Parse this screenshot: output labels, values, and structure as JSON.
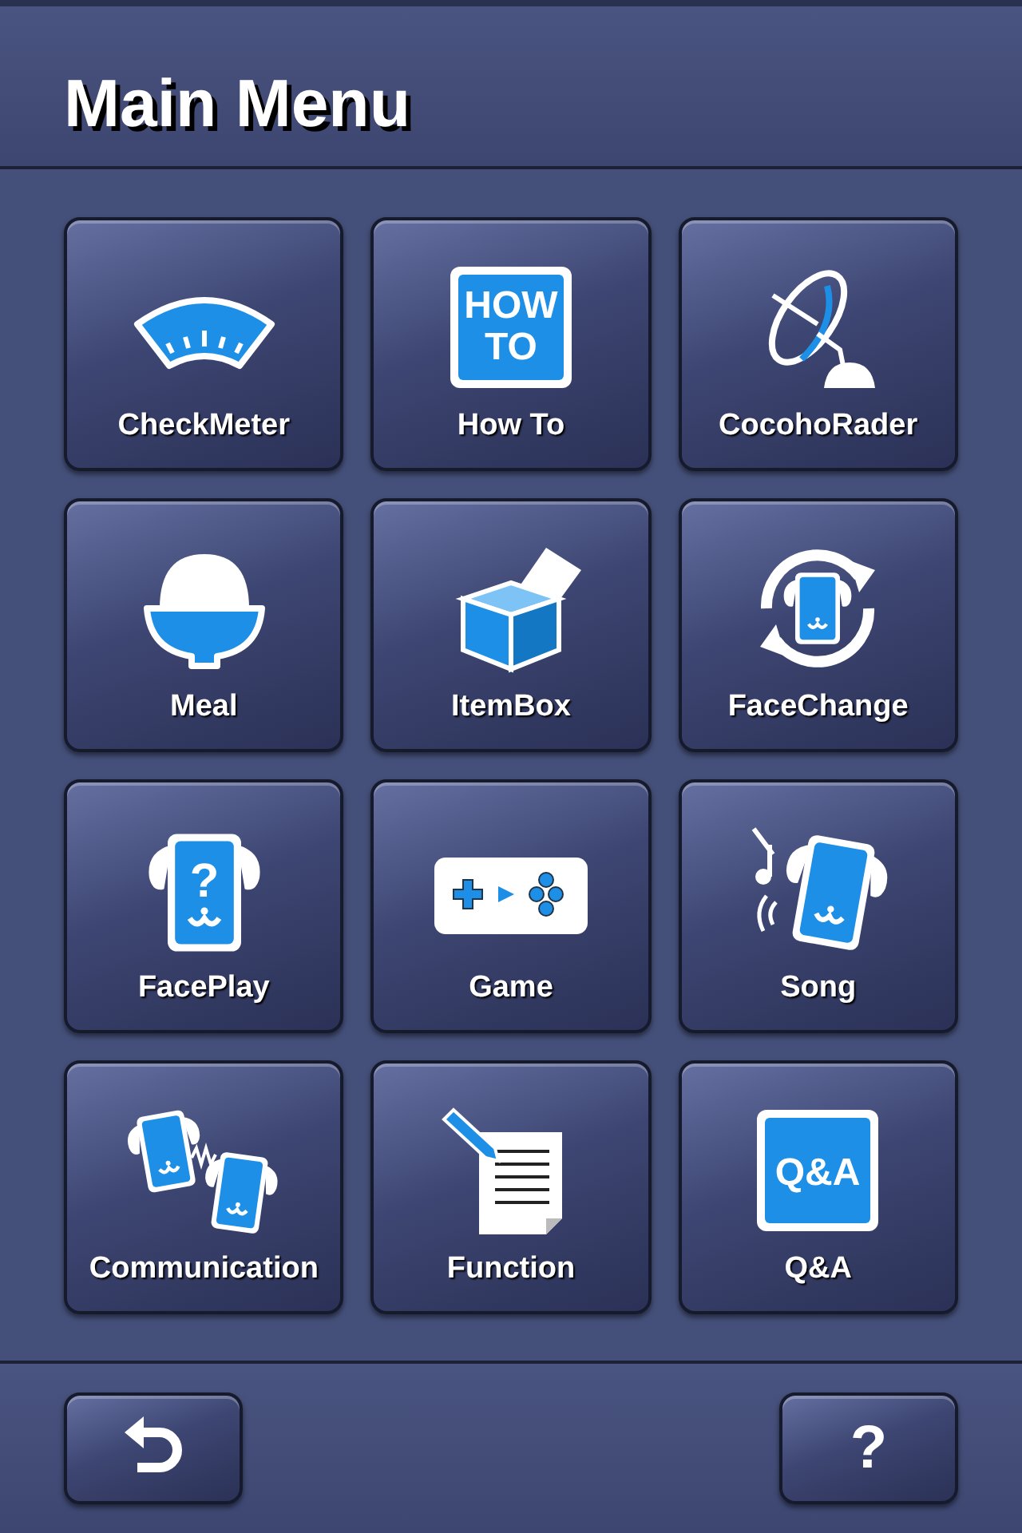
{
  "header": {
    "title": "Main Menu"
  },
  "menu": [
    {
      "kind": "meter",
      "label": "CheckMeter"
    },
    {
      "kind": "howto",
      "label": "How To",
      "icon_text": [
        "HOW",
        "TO"
      ]
    },
    {
      "kind": "radar",
      "label": "CocohoRader"
    },
    {
      "kind": "bowl",
      "label": "Meal"
    },
    {
      "kind": "box",
      "label": "ItemBox"
    },
    {
      "kind": "facechange",
      "label": "FaceChange"
    },
    {
      "kind": "faceplay",
      "label": "FacePlay",
      "icon_text": [
        "?"
      ]
    },
    {
      "kind": "game",
      "label": "Game"
    },
    {
      "kind": "song",
      "label": "Song"
    },
    {
      "kind": "comm",
      "label": "Communication"
    },
    {
      "kind": "doc",
      "label": "Function"
    },
    {
      "kind": "qa",
      "label": "Q&A",
      "icon_text": [
        "Q&A"
      ]
    }
  ],
  "footer": {
    "back_button": {
      "kind": "back"
    },
    "help_button": {
      "label": "?"
    }
  }
}
